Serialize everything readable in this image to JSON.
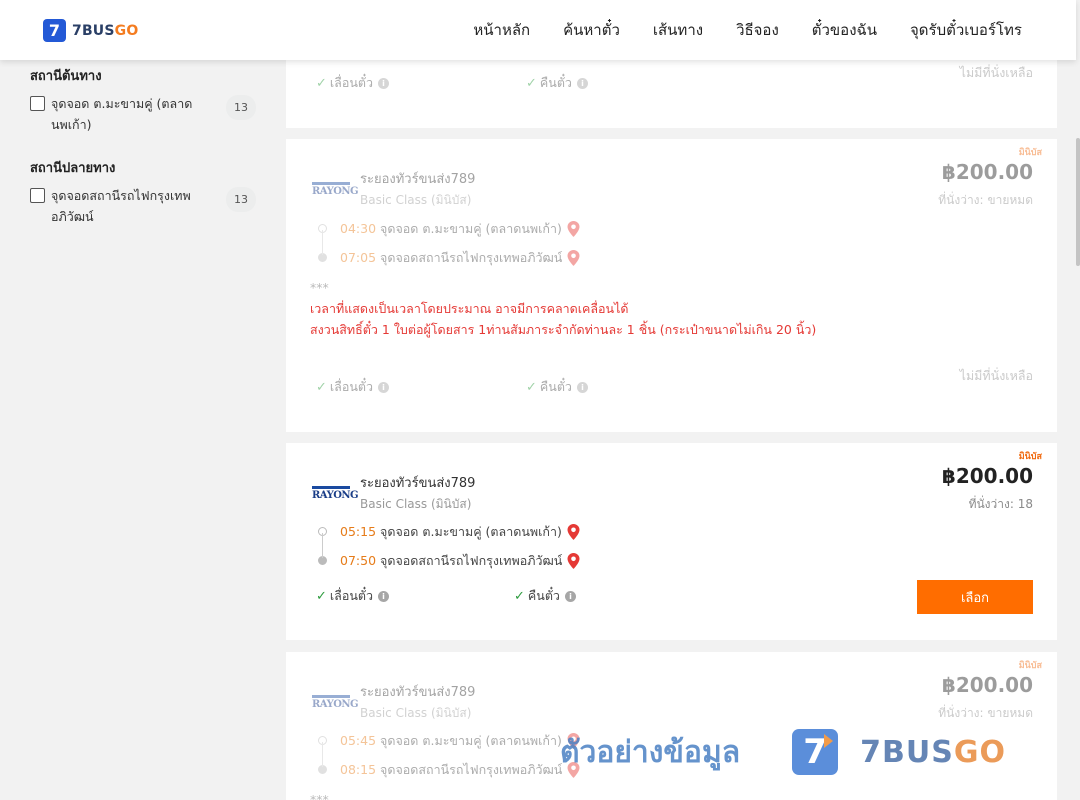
{
  "header": {
    "logo_digit": "7",
    "logo_text_a": "7BUS",
    "logo_text_b": "GO",
    "nav": [
      "หน้าหลัก",
      "ค้นหาตั๋ว",
      "เส้นทาง",
      "วิธีจอง",
      "ตั๋วของฉัน",
      "จุดรับตั๋วเบอร์โทร"
    ]
  },
  "sidebar": {
    "origin_title": "สถานีต้นทาง",
    "origin_item": "จุดจอด ต.มะขามคู่ (ตลาดนพเก้า)",
    "origin_count": "13",
    "dest_title": "สถานีปลายทาง",
    "dest_item": "จุดจอดสถานีรถไฟกรุงเทพอภิวัฒน์",
    "dest_count": "13"
  },
  "common": {
    "operator_logo": "RAYONG",
    "operator_name": "ระยองทัวร์ขนส่ง789",
    "bus_class": "Basic Class (มินิบัส)",
    "badge": "มินิบัส",
    "origin_stop": "จุดจอด ต.มะขามคู่ (ตลาดนพเก้า)",
    "dest_stop": "จุดจอดสถานีรถไฟกรุงเทพอภิวัฒน์",
    "change_ticket": "เลื่อนตั๋ว",
    "refund_ticket": "คืนตั๋ว",
    "check": "✓",
    "info": "i",
    "no_seats": "ไม่มีที่นั่งเหลือ",
    "note_stars": "***",
    "note_line1": "เวลาที่แสดงเป็นเวลาโดยประมาณ อาจมีการคลาดเคลื่อนได้",
    "note_line2": "สงวนสิทธิ์ตั๋ว 1 ใบต่อผู้โดยสาร 1ท่านสัมภาระจำกัดท่านละ 1 ชิ้น (กระเป๋าขนาดไม่เกิน 20 นิ้ว)"
  },
  "trips": [
    {
      "depart": "04:30",
      "arrive": "07:05",
      "price": "฿200.00",
      "seats": "ที่นั่งว่าง: ขายหมด"
    },
    {
      "depart": "05:15",
      "arrive": "07:50",
      "price": "฿200.00",
      "seats": "ที่นั่งว่าง: 18",
      "select_label": "เลือก"
    },
    {
      "depart": "05:45",
      "arrive": "08:15",
      "price": "฿200.00",
      "seats": "ที่นั่งว่าง: ขายหมด"
    }
  ],
  "watermark": {
    "text": "ตัวอย่างข้อมูล",
    "logo_digit": "7",
    "brand_a": "7BUS",
    "brand_b": "GO"
  },
  "colors": {
    "accent": "#ff6d00",
    "brand_blue": "#2359d6",
    "warn": "#e53935",
    "time": "#e67c1a"
  }
}
